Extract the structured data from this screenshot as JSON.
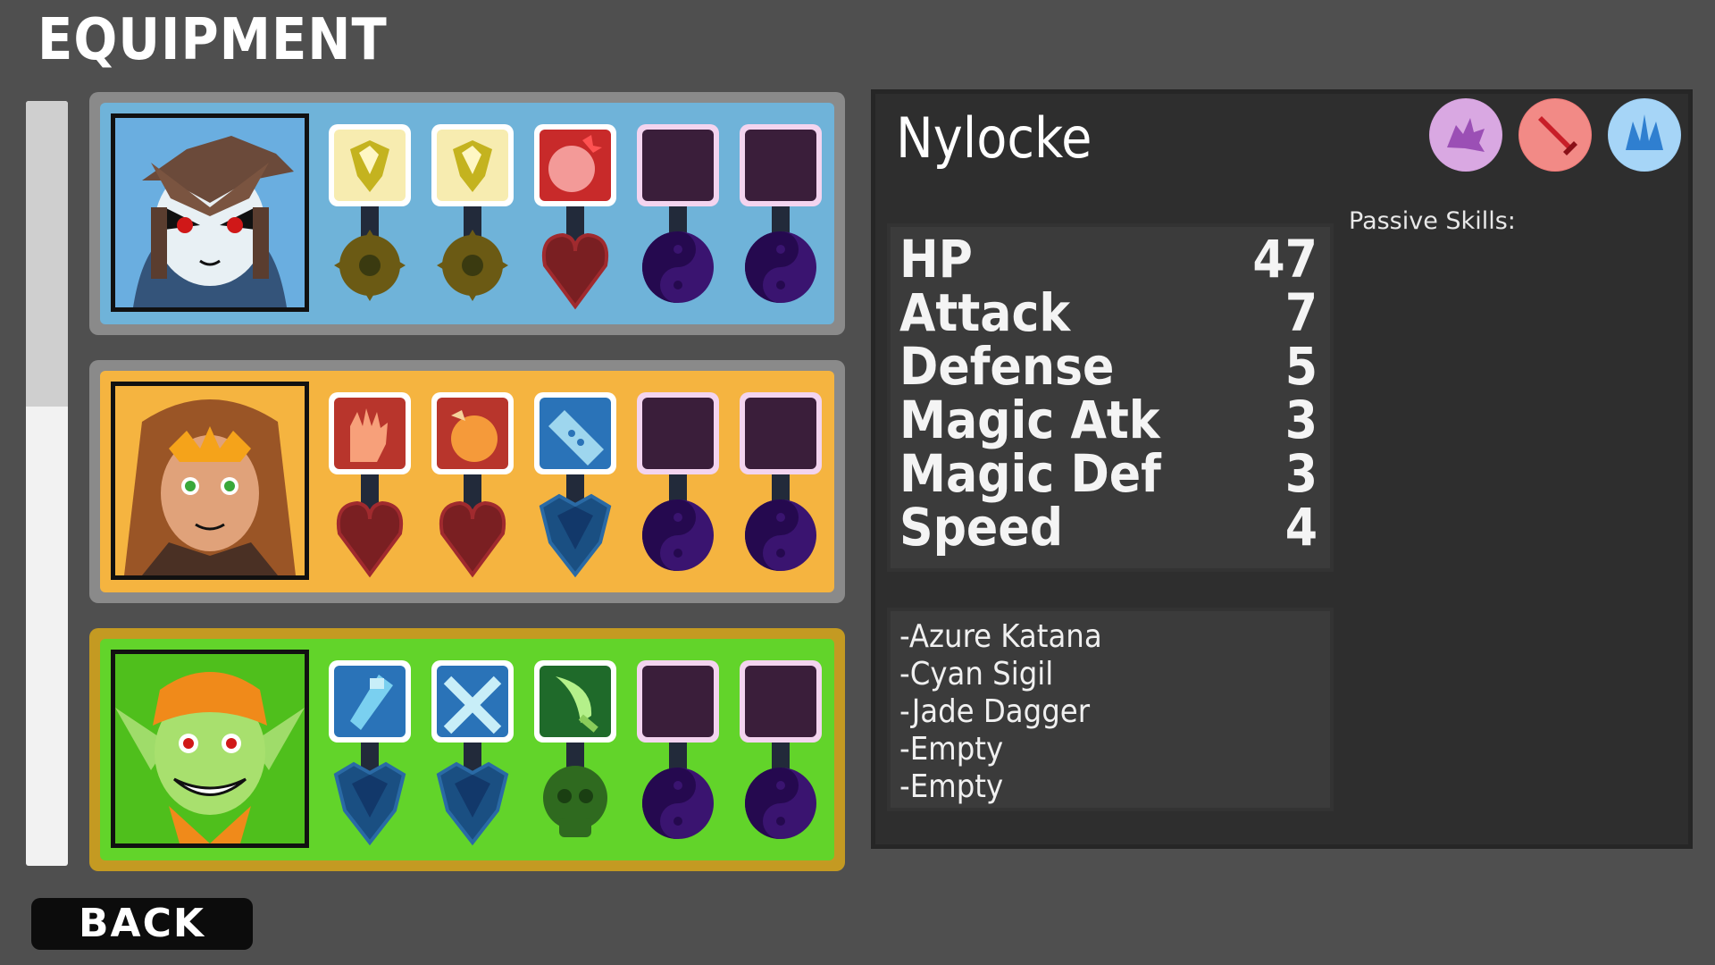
{
  "screen": {
    "title": "EQUIPMENT"
  },
  "party": [
    {
      "name": "Nylocke",
      "card_bg": "#6fb3d9",
      "card_frame": "#8a8a8a",
      "slots": [
        {
          "item_icon": "diamond-shard-icon",
          "slot_type": "gear-icon"
        },
        {
          "item_icon": "diamond-shard-icon",
          "slot_type": "gear-icon"
        },
        {
          "item_icon": "pomegranate-icon",
          "slot_type": "heart-icon"
        },
        {
          "item_icon": "empty-slot",
          "slot_type": "yin-yang-icon"
        },
        {
          "item_icon": "empty-slot",
          "slot_type": "yin-yang-icon"
        }
      ]
    },
    {
      "name": "",
      "card_bg": "#f5b440",
      "card_frame": "#8a8a8a",
      "slots": [
        {
          "item_icon": "glove-icon",
          "slot_type": "heart-icon"
        },
        {
          "item_icon": "fruit-icon",
          "slot_type": "heart-icon"
        },
        {
          "item_icon": "bandage-icon",
          "slot_type": "shield-crest-icon"
        },
        {
          "item_icon": "empty-slot",
          "slot_type": "yin-yang-icon"
        },
        {
          "item_icon": "empty-slot",
          "slot_type": "yin-yang-icon"
        }
      ]
    },
    {
      "name": "",
      "card_bg": "#62d42a",
      "card_frame": "#c49a22",
      "slots": [
        {
          "item_icon": "azure-katana-icon",
          "slot_type": "shield-crest-icon"
        },
        {
          "item_icon": "cyan-sigil-icon",
          "slot_type": "shield-crest-icon"
        },
        {
          "item_icon": "jade-dagger-icon",
          "slot_type": "skull-icon"
        },
        {
          "item_icon": "empty-slot",
          "slot_type": "yin-yang-icon"
        },
        {
          "item_icon": "empty-slot",
          "slot_type": "yin-yang-icon"
        }
      ]
    }
  ],
  "details": {
    "name": "Nylocke",
    "badges": [
      {
        "icon": "dragon-icon",
        "color": "#d6a3df"
      },
      {
        "icon": "sword-icon",
        "color": "#f07a78"
      },
      {
        "icon": "crystal-icon",
        "color": "#9fd0f5"
      }
    ],
    "stats": [
      {
        "label": "HP",
        "value": "47"
      },
      {
        "label": "Attack",
        "value": "7"
      },
      {
        "label": "Defense",
        "value": "5"
      },
      {
        "label": "Magic Atk",
        "value": "3"
      },
      {
        "label": "Magic Def",
        "value": "3"
      },
      {
        "label": "Speed",
        "value": "4"
      }
    ],
    "passive_label": "Passive Skills:",
    "equipment_list": [
      "-Azure Katana",
      "-Cyan Sigil",
      "-Jade Dagger",
      "-Empty",
      "-Empty"
    ]
  },
  "footer": {
    "back_label": "BACK"
  },
  "scroll": {
    "thumb_fraction": 0.4
  }
}
